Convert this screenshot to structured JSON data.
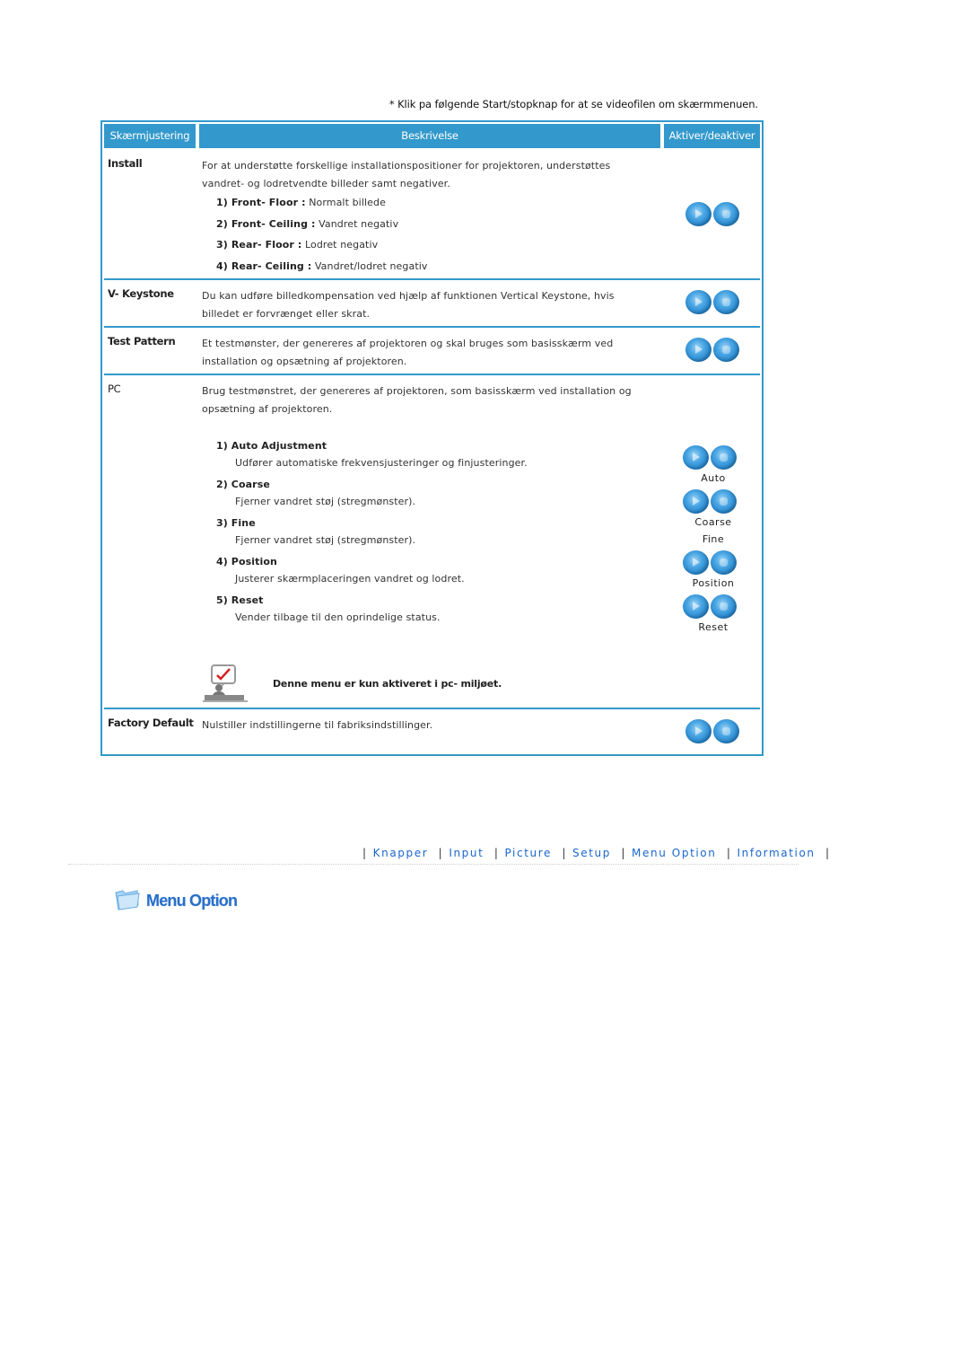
{
  "note": "* Klik pa følgende Start/stopknap for at se videofilen om skærmmenuen.",
  "table": {
    "headers": [
      "Skærmjustering",
      "Beskrivelse",
      "Aktiver/deaktiver"
    ],
    "rows": {
      "install": {
        "label": "Install",
        "desc": "For at understøtte forskellige installationspositioner for projektoren, understøttes vandret-  og lodretvendte billeder samt negativer.",
        "items": [
          {
            "num": "1)",
            "name": "Front- Floor",
            "value": "Normalt billede"
          },
          {
            "num": "2)",
            "name": "Front- Ceiling",
            "value": "Vandret negativ"
          },
          {
            "num": "3)",
            "name": "Rear- Floor",
            "value": "Lodret negativ"
          },
          {
            "num": "4)",
            "name": "Rear- Ceiling",
            "value": "Vandret/lodret negativ"
          }
        ]
      },
      "keystone": {
        "label": "V- Keystone",
        "desc": "Du kan udføre billedkompensation ved hjælp af funktionen Vertical Keystone, hvis billedet er forvrænget eller skrat."
      },
      "testpattern": {
        "label": "Test Pattern",
        "desc": "Et testmønster, der genereres af projektoren og skal bruges som basisskærm ved installation og opsætning af projektoren."
      },
      "pc": {
        "label": "PC",
        "desc": "Brug testmønstret, der genereres af projektoren, som basisskærm ved installation og opsætning af projektoren.",
        "items": [
          {
            "title": "1) Auto Adjustment",
            "desc": "Udfører automatiske frekvensjusteringer og finjusteringer."
          },
          {
            "title": "2) Coarse",
            "desc": "Fjerner vandret støj (stregmønster)."
          },
          {
            "title": "3) Fine",
            "desc": "Fjerner vandret støj (stregmønster)."
          },
          {
            "title": "4) Position",
            "desc": "Justerer skærmplaceringen vandret og lodret."
          },
          {
            "title": "5) Reset",
            "desc": "Vender tilbage til den oprindelige status."
          }
        ],
        "controls": [
          "Auto",
          "Coarse",
          "Fine",
          "Position",
          "Reset"
        ],
        "note": "Denne menu er kun aktiveret i pc- miljøet."
      },
      "factory": {
        "label": "Factory Default",
        "desc": "Nulstiller indstillingerne til fabriksindstillinger."
      }
    }
  },
  "nav": {
    "links": [
      "Knapper",
      "Input",
      "Picture",
      "Setup",
      "Menu Option",
      "Information"
    ],
    "separator": "|"
  },
  "section": {
    "title": "Menu Option",
    "icon": "folder-icon"
  },
  "colors": {
    "header_bg": "#3399cc",
    "link": "#1a66cc"
  }
}
